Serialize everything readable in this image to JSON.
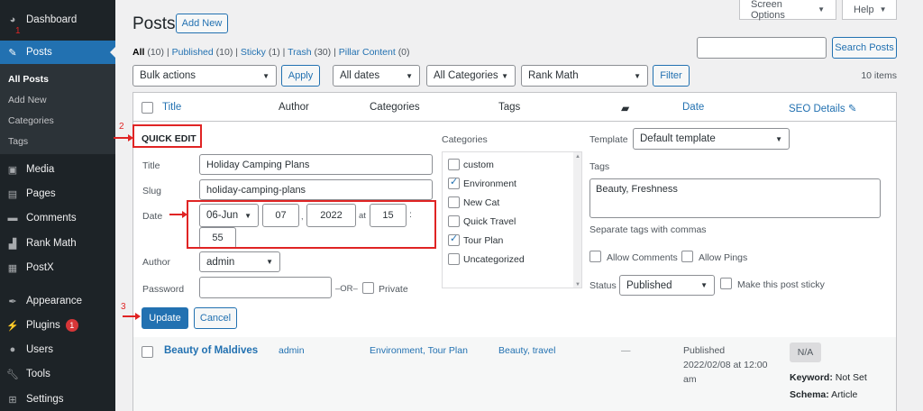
{
  "sidebar": {
    "items": [
      {
        "label": "Dashboard",
        "icon": "dashboard-icon"
      },
      {
        "label": "Posts",
        "icon": "pin-icon"
      },
      {
        "label": "Media",
        "icon": "media-icon"
      },
      {
        "label": "Pages",
        "icon": "pages-icon"
      },
      {
        "label": "Comments",
        "icon": "comments-icon"
      },
      {
        "label": "Rank Math",
        "icon": "rank-math-icon"
      },
      {
        "label": "PostX",
        "icon": "postx-icon"
      },
      {
        "label": "Appearance",
        "icon": "appearance-icon"
      },
      {
        "label": "Plugins",
        "icon": "plugins-icon",
        "badge": "1"
      },
      {
        "label": "Users",
        "icon": "users-icon"
      },
      {
        "label": "Tools",
        "icon": "tools-icon"
      },
      {
        "label": "Settings",
        "icon": "settings-icon"
      }
    ],
    "submenu": [
      "All Posts",
      "Add New",
      "Categories",
      "Tags"
    ]
  },
  "header": {
    "title": "Posts",
    "add_new": "Add New",
    "screen_options": "Screen Options",
    "help": "Help"
  },
  "views": {
    "all": "All",
    "all_count": "(10)",
    "published": "Published",
    "published_count": "(10)",
    "sticky": "Sticky",
    "sticky_count": "(1)",
    "trash": "Trash",
    "trash_count": "(30)",
    "pillar": "Pillar Content",
    "pillar_count": "(0)",
    "sep": "|"
  },
  "search": {
    "button": "Search Posts",
    "value": ""
  },
  "filters": {
    "bulk": "Bulk actions",
    "apply": "Apply",
    "dates": "All dates",
    "categories": "All Categories",
    "rank_math": "Rank Math",
    "filter": "Filter",
    "items": "10 items"
  },
  "table": {
    "headers": {
      "title": "Title",
      "author": "Author",
      "categories": "Categories",
      "tags": "Tags",
      "date": "Date",
      "seo": "SEO Details"
    }
  },
  "quick_edit": {
    "heading": "QUICK EDIT",
    "title_label": "Title",
    "title_value": "Holiday Camping Plans",
    "slug_label": "Slug",
    "slug_value": "holiday-camping-plans",
    "date_label": "Date",
    "month": "06-Jun",
    "day": "07",
    "year": "2022",
    "at": "at",
    "hour": "15",
    "colon": ":",
    "minute": "55",
    "comma": ",",
    "author_label": "Author",
    "author_value": "admin",
    "password_label": "Password",
    "password_value": "",
    "or": "–OR–",
    "private": "Private",
    "categories_label": "Categories",
    "categories": [
      {
        "label": "custom",
        "checked": false
      },
      {
        "label": "Environment",
        "checked": true
      },
      {
        "label": "New Cat",
        "checked": false
      },
      {
        "label": "Quick Travel",
        "checked": false
      },
      {
        "label": "Tour Plan",
        "checked": true
      },
      {
        "label": "Uncategorized",
        "checked": false
      }
    ],
    "template_label": "Template",
    "template_value": "Default template",
    "tags_label": "Tags",
    "tags_value": "Beauty, Freshness",
    "tags_hint": "Separate tags with commas",
    "allow_comments": "Allow Comments",
    "allow_pings": "Allow Pings",
    "status_label": "Status",
    "status_value": "Published",
    "sticky": "Make this post sticky",
    "update": "Update",
    "cancel": "Cancel"
  },
  "row": {
    "title": "Beauty of Maldives",
    "author": "admin",
    "categories": "Environment, Tour Plan",
    "tags": "Beauty, travel",
    "comments": "—",
    "date_status": "Published",
    "date_value": "2022/02/08 at 12:00",
    "date_suffix": "am",
    "seo_score": "N/A",
    "keyword_label": "Keyword:",
    "keyword_value": "Not Set",
    "schema_label": "Schema:",
    "schema_value": "Article"
  },
  "annotations": [
    "1",
    "2",
    "3"
  ],
  "colors": {
    "accent": "#2271b1",
    "annotation": "#e02424",
    "sidebar": "#1d2327"
  }
}
